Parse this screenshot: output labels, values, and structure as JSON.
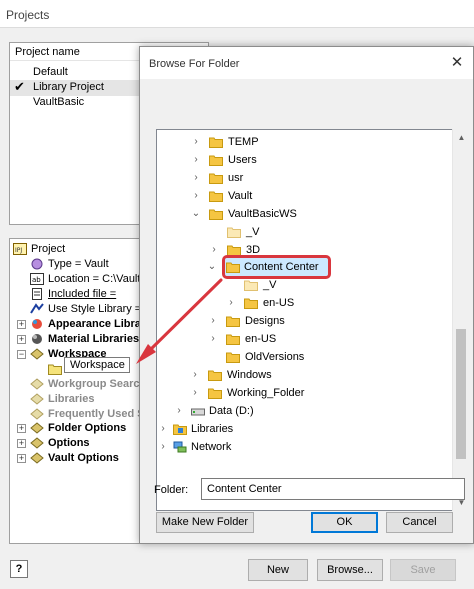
{
  "window": {
    "title": "Projects"
  },
  "project_list": {
    "header": "Project name",
    "items": [
      {
        "label": "Default",
        "selected": false
      },
      {
        "label": "Library Project",
        "selected": true
      },
      {
        "label": "VaultBasic",
        "selected": false
      }
    ]
  },
  "project_tree": {
    "root": "Project",
    "type": "Type = Vault",
    "location": "Location = C:\\VaultB",
    "included": "Included file =",
    "style": "Use Style Library = R",
    "appearance": "Appearance Librar",
    "material": "Material Libraries",
    "workspace": "Workspace",
    "workspace_value": "Workspace",
    "workgroup": "Workgroup Search",
    "libraries": "Libraries",
    "frequent": "Frequently Used S",
    "folder_options": "Folder Options",
    "options": "Options",
    "vault_options": "Vault Options"
  },
  "dialog": {
    "title": "Browse For Folder",
    "close": "✕",
    "folders": [
      {
        "name": "TEMP"
      },
      {
        "name": "Users"
      },
      {
        "name": "usr"
      },
      {
        "name": "Vault"
      },
      {
        "name": "VaultBasicWS"
      },
      {
        "name": "_V"
      },
      {
        "name": "3D"
      },
      {
        "name": "Content Center"
      },
      {
        "name": "_V"
      },
      {
        "name": "en-US"
      },
      {
        "name": "Designs"
      },
      {
        "name": "en-US"
      },
      {
        "name": "OldVersions"
      },
      {
        "name": "Windows"
      },
      {
        "name": "Working_Folder"
      },
      {
        "name": "Data (D:)"
      },
      {
        "name": "Libraries"
      },
      {
        "name": "Network"
      }
    ],
    "folder_label": "Folder:",
    "folder_value": "Content Center",
    "make_new_folder": "Make New Folder",
    "ok": "OK",
    "cancel": "Cancel"
  },
  "buttons": {
    "help": "?",
    "new": "New",
    "browse": "Browse...",
    "save": "Save"
  },
  "colors": {
    "accent": "#0078d7",
    "highlight": "#d9363e",
    "folder": "#f5c542",
    "selection": "#cce8ff"
  }
}
